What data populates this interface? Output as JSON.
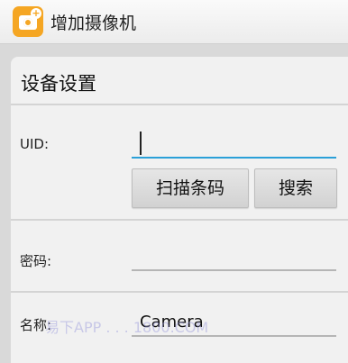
{
  "header": {
    "app_icon": "camera-add-icon",
    "title": "增加摄像机"
  },
  "form": {
    "section_title": "设备设置",
    "uid": {
      "label": "UID:",
      "value": ""
    },
    "buttons": {
      "scan": "扫描条码",
      "search": "搜索"
    },
    "password": {
      "label": "密码:",
      "value": ""
    },
    "name": {
      "label": "名称:",
      "value": "Camera"
    }
  },
  "watermark": "易下APP . . . 1800.COM",
  "colors": {
    "accent": "#2ba0d8",
    "app_icon": "#f5a623"
  }
}
